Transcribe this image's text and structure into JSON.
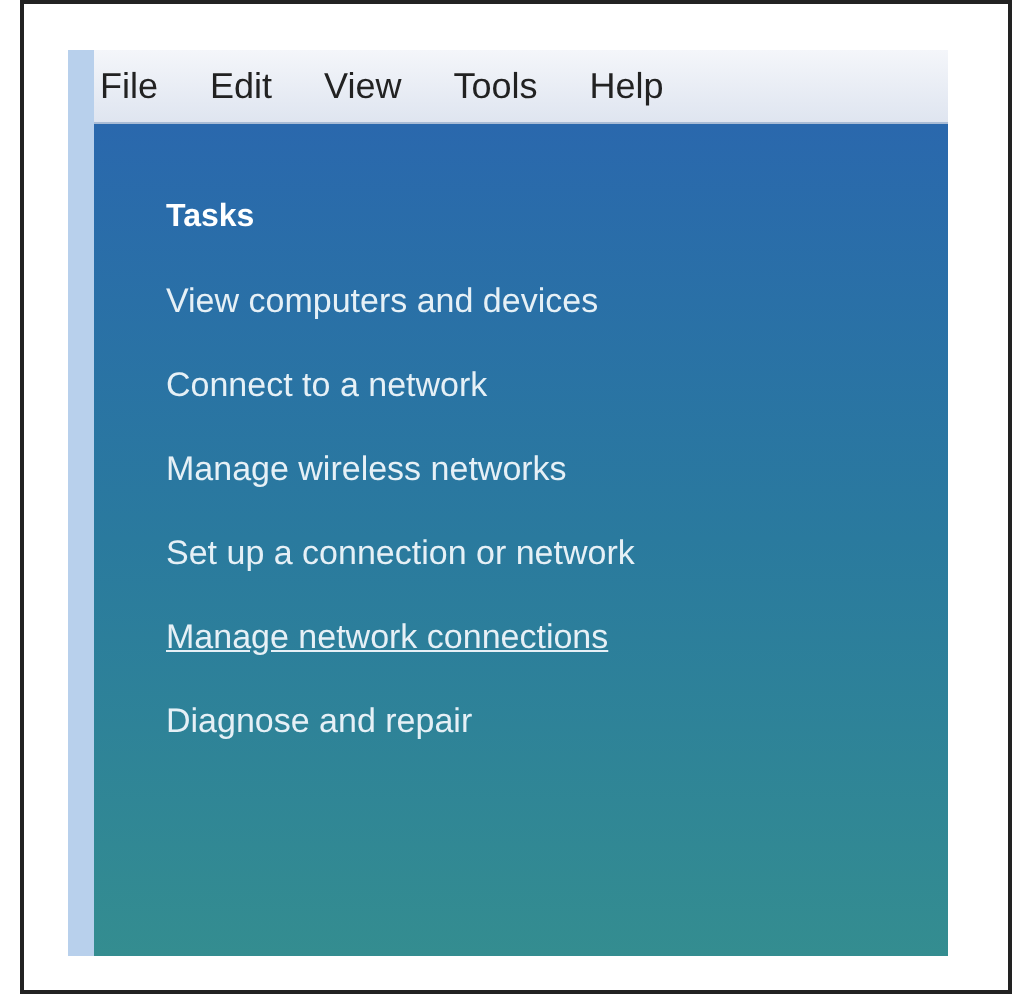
{
  "menu_bar": [
    "File",
    "Edit",
    "View",
    "Tools",
    "Help"
  ],
  "tasks_pane": {
    "heading": "Tasks",
    "links": [
      {
        "label": "View computers and devices",
        "hovered": false
      },
      {
        "label": "Connect to a network",
        "hovered": false
      },
      {
        "label": "Manage wireless networks",
        "hovered": false
      },
      {
        "label": "Set up a connection or network",
        "hovered": false
      },
      {
        "label": "Manage network connections",
        "hovered": true
      },
      {
        "label": "Diagnose and repair",
        "hovered": false
      }
    ]
  }
}
